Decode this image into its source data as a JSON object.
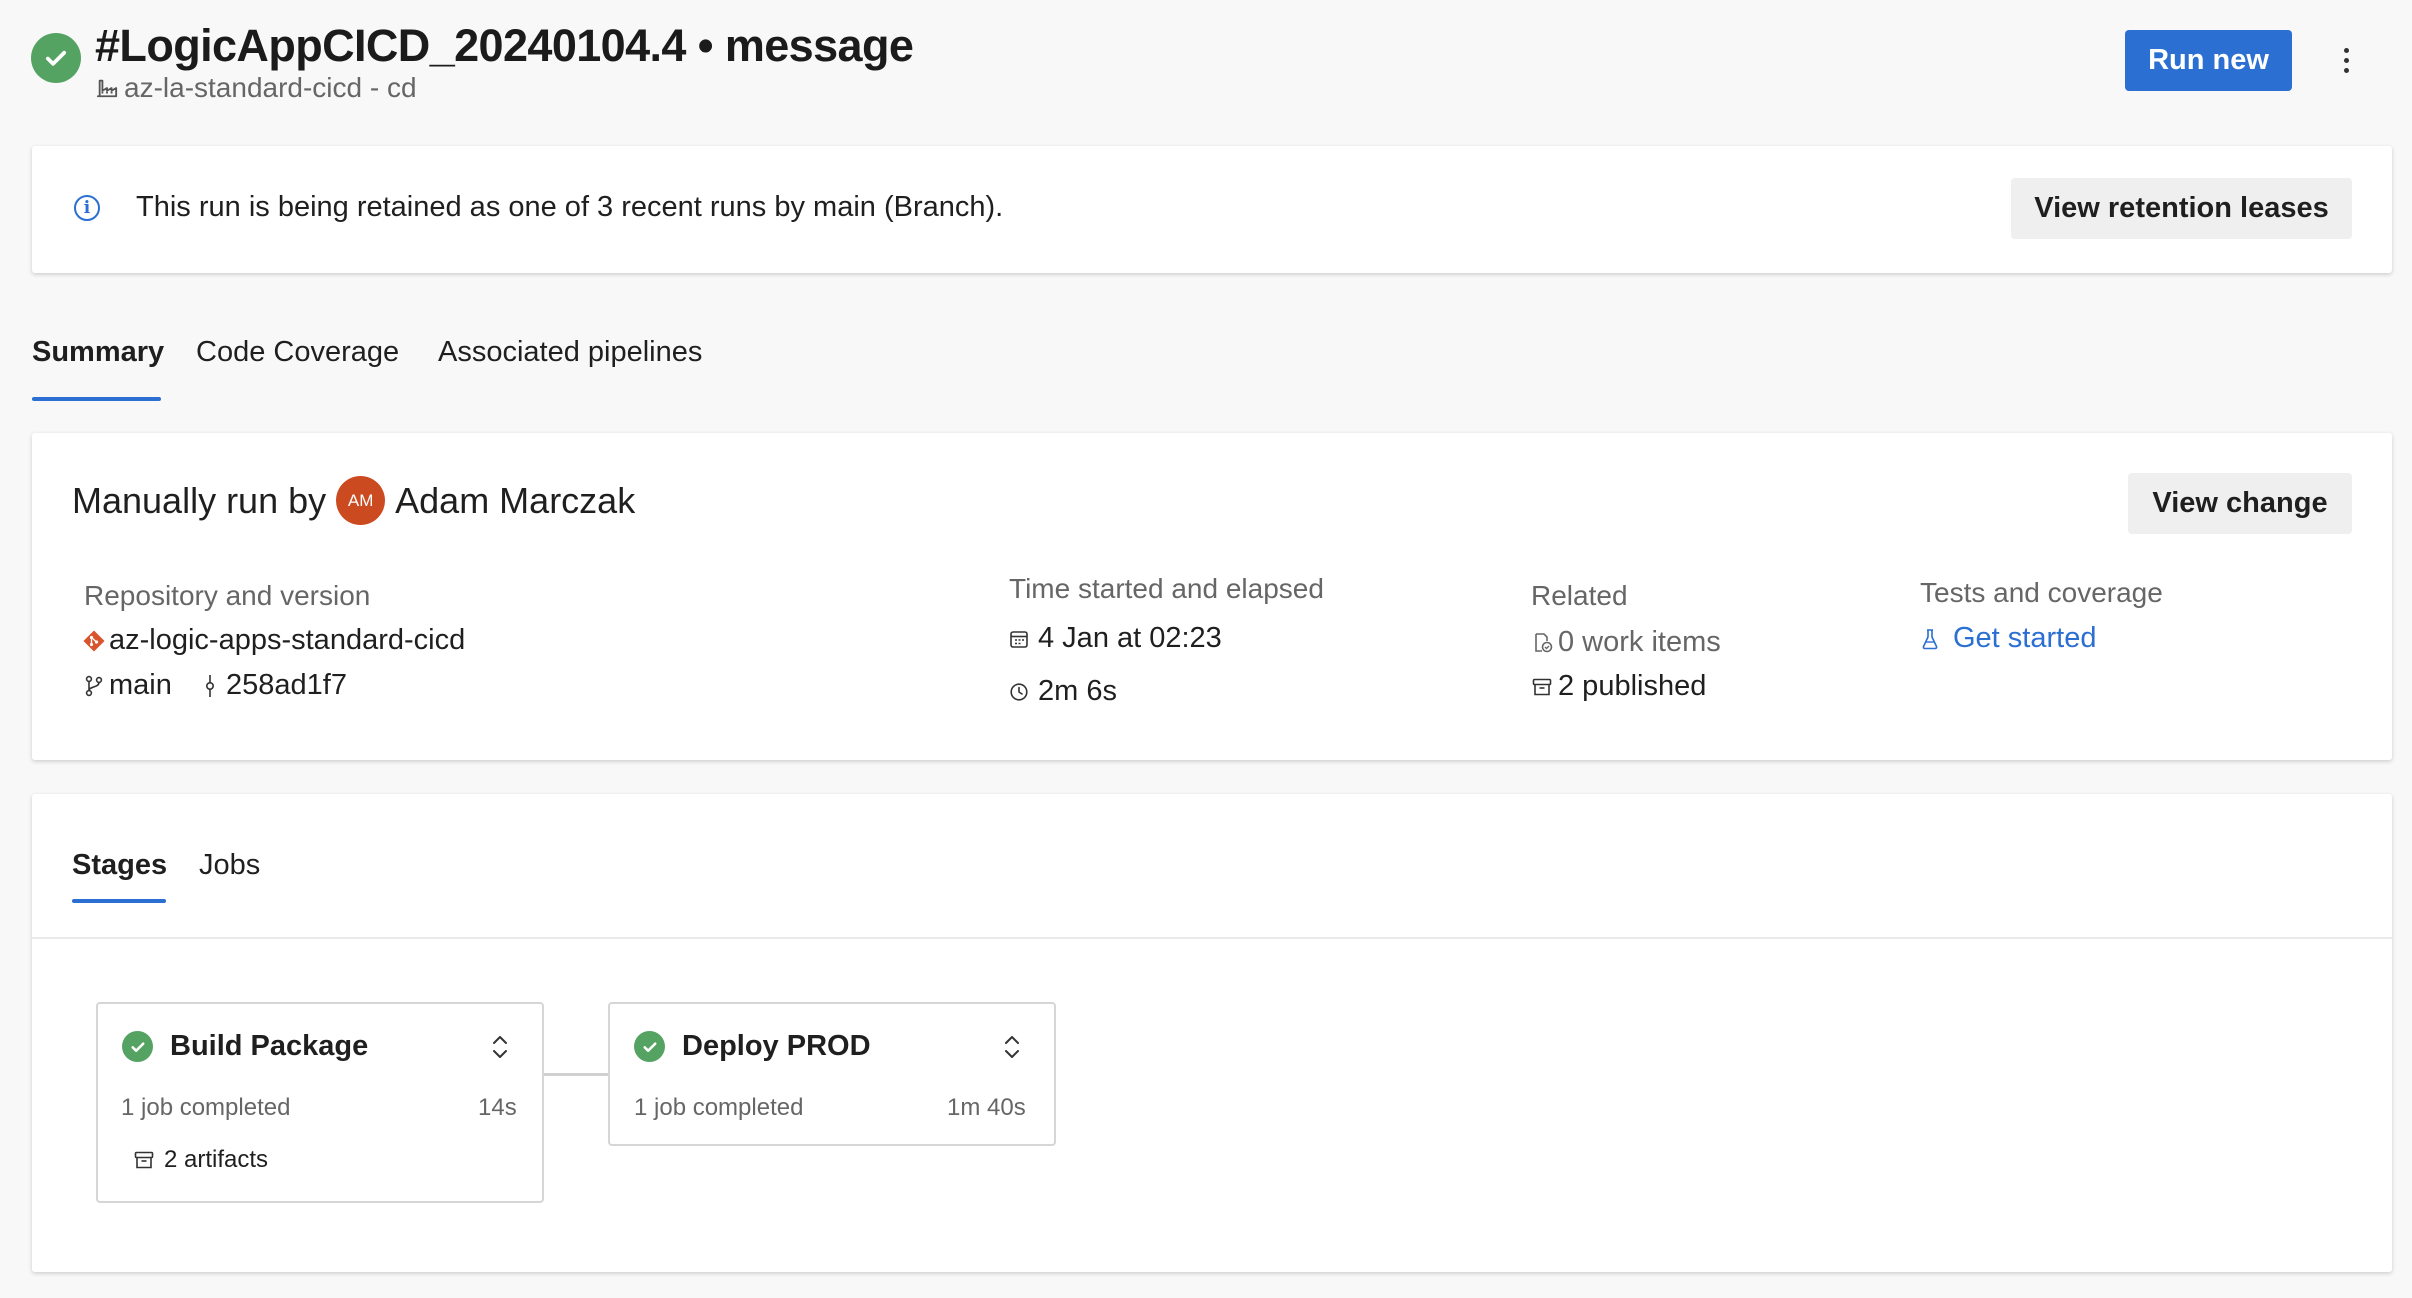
{
  "header": {
    "title": "#LogicAppCICD_20240104.4 • message",
    "pipeline": "az-la-standard-cicd - cd",
    "run_new_label": "Run new",
    "more_label": "⋮"
  },
  "banner": {
    "message": "This run is being retained as one of 3 recent runs by main (Branch).",
    "button_label": "View retention leases"
  },
  "tabs": [
    {
      "label": "Summary",
      "active": true
    },
    {
      "label": "Code Coverage",
      "active": false
    },
    {
      "label": "Associated pipelines",
      "active": false
    }
  ],
  "summary": {
    "run_by_prefix": "Manually run by",
    "avatar_initials": "AM",
    "user_name": "Adam Marczak",
    "view_change_label": "View change",
    "repository": {
      "label": "Repository and version",
      "repo_name": "az-logic-apps-standard-cicd",
      "branch": "main",
      "commit": "258ad1f7"
    },
    "time": {
      "label": "Time started and elapsed",
      "started": "4 Jan at 02:23",
      "elapsed": "2m 6s"
    },
    "related": {
      "label": "Related",
      "work_items": "0 work items",
      "published": "2 published"
    },
    "tests": {
      "label": "Tests and coverage",
      "link": "Get started"
    }
  },
  "stages_panel": {
    "tabs": [
      {
        "label": "Stages",
        "active": true
      },
      {
        "label": "Jobs",
        "active": false
      }
    ],
    "stages": [
      {
        "name": "Build Package",
        "status": "1 job completed",
        "duration": "14s",
        "artifacts": "2 artifacts"
      },
      {
        "name": "Deploy PROD",
        "status": "1 job completed",
        "duration": "1m 40s"
      }
    ]
  },
  "colors": {
    "accent": "#2a6fd1",
    "success": "#55a362",
    "avatar": "#cc4a1f",
    "repo_icon": "#d9532c"
  }
}
